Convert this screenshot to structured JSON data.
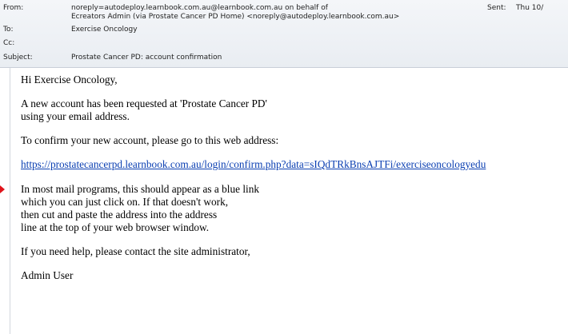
{
  "header": {
    "from_label": "From:",
    "from_line1": "noreply=autodeploy.learnbook.com.au@learnbook.com.au on behalf of",
    "from_line2": "Ecreators Admin (via Prostate Cancer PD Home) <noreply@autodeploy.learnbook.com.au>",
    "sent_label": "Sent:",
    "sent_value": "Thu 10/",
    "to_label": "To:",
    "to_value": "Exercise Oncology",
    "cc_label": "Cc:",
    "subject_label": "Subject:",
    "subject_value": "Prostate Cancer PD: account confirmation"
  },
  "message": {
    "greeting": "Hi Exercise Oncology,",
    "p1_line1": "A new account has been requested at 'Prostate Cancer PD'",
    "p1_line2": "using your email address.",
    "p2": "To confirm your new account, please go to this web address:",
    "link": "https://prostatecancerpd.learnbook.com.au/login/confirm.php?data=sIQdTRkBnsAJTFi/exerciseoncologyedu",
    "p3_line1": "In most mail programs, this should appear as a blue link",
    "p3_line2": "which you can just click on. If that doesn't work,",
    "p3_line3": "then cut and paste the address into the address",
    "p3_line4": "line at the top of your web browser window.",
    "p4": "If you need help, please contact the site administrator,",
    "signature": "Admin User"
  },
  "colors": {
    "link": "#0b3fb2",
    "arrow": "#e0141b",
    "header_bg": "#eef1f5"
  }
}
